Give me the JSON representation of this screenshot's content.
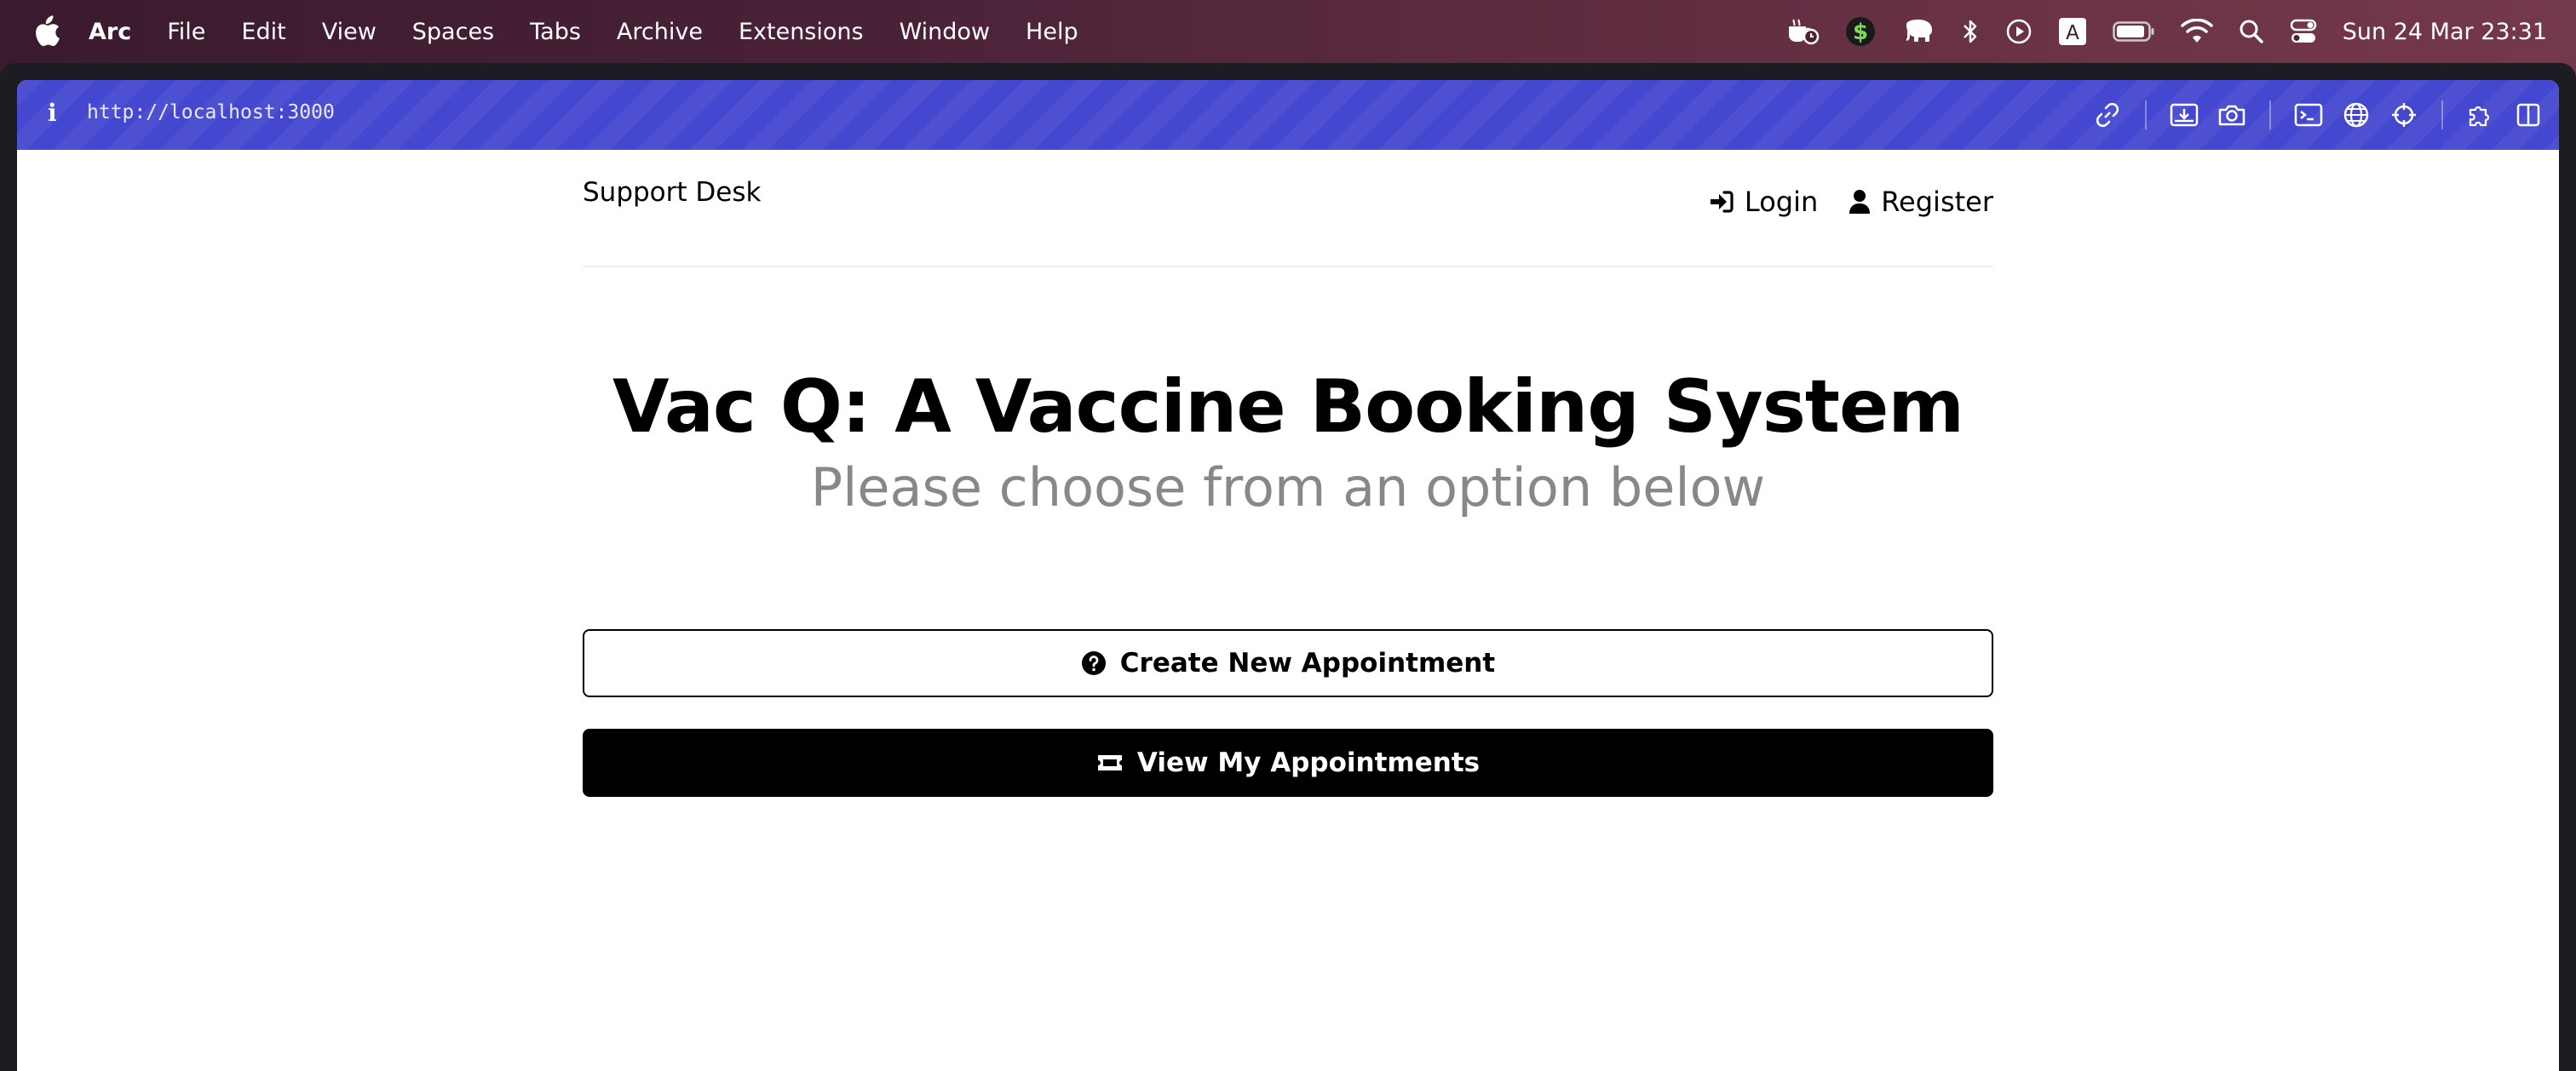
{
  "menubar": {
    "app_name": "Arc",
    "menus": [
      "File",
      "Edit",
      "View",
      "Spaces",
      "Tabs",
      "Archive",
      "Extensions",
      "Window",
      "Help"
    ],
    "status_icons": [
      "coffee-timer-icon",
      "dollar-app-icon",
      "elephant-icon",
      "bluetooth-icon",
      "play-circle-icon",
      "input-source-icon",
      "battery-icon",
      "wifi-icon",
      "spotlight-search-icon",
      "control-center-icon"
    ],
    "input_source_label": "A",
    "clock": "Sun 24 Mar  23:31"
  },
  "browser": {
    "info_label": "i",
    "url": "http://localhost:3000",
    "accent_color": "#4447d0"
  },
  "header": {
    "logo": "Support Desk",
    "nav": {
      "login": "Login",
      "register": "Register"
    }
  },
  "hero": {
    "title": "Vac Q: A Vaccine Booking System",
    "subtitle": "Please choose from an option below"
  },
  "actions": {
    "create": "Create New Appointment",
    "view": "View My Appointments"
  }
}
